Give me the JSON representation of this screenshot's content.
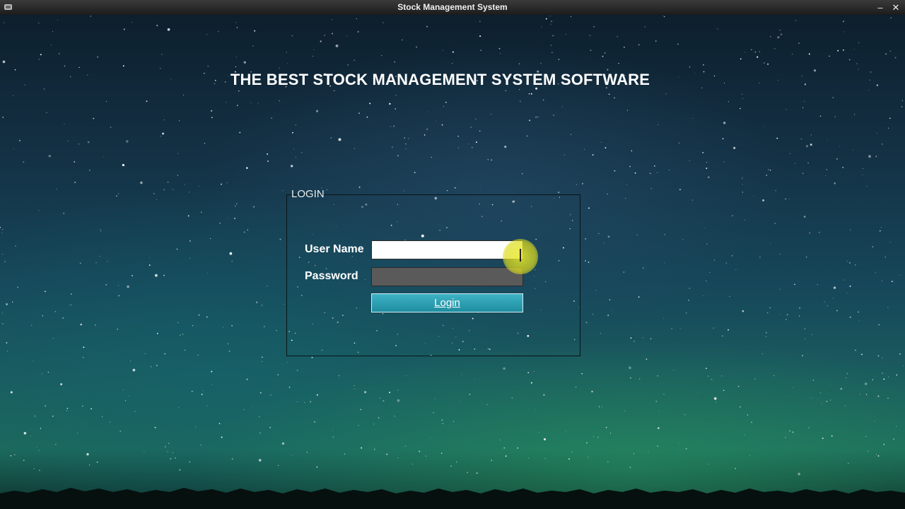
{
  "window": {
    "title": "Stock Management System",
    "minimize_glyph": "–",
    "close_glyph": "✕"
  },
  "page": {
    "headline": "THE BEST STOCK MANAGEMENT SYSTEM SOFTWARE"
  },
  "login": {
    "legend": "LOGIN",
    "username_label": "User Name",
    "username_value": "",
    "password_label": "Password",
    "password_value": "",
    "button_label": "Login"
  },
  "colors": {
    "button": "#2aa1b4",
    "password_field": "#5a5a5a",
    "cursor_highlight": "#e6e628"
  }
}
